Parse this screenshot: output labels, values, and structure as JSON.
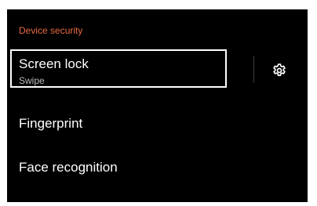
{
  "section": {
    "header": "Device security"
  },
  "items": [
    {
      "title": "Screen lock",
      "subtitle": "Swipe",
      "settings_icon": "gear-icon"
    },
    {
      "title": "Fingerprint"
    },
    {
      "title": "Face recognition"
    }
  ],
  "colors": {
    "background": "#000000",
    "accent": "#e86a43",
    "text_primary": "#ffffff",
    "text_secondary": "#b9b9b9"
  }
}
